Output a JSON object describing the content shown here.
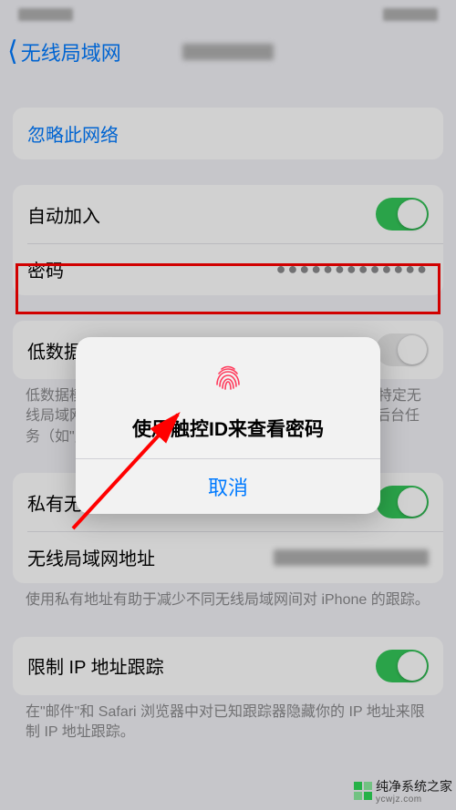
{
  "nav": {
    "back_label": "无线局域网"
  },
  "sections": {
    "forget_label": "忽略此网络",
    "auto_join_label": "自动加入",
    "password_label": "密码",
    "password_value": "●●●●●●●●●●●●●",
    "low_data_label": "低数据模式",
    "low_data_footer": "低数据模式有助于减少iPhone通过蜂窝网络或你选择的特定无线局域网使用的数据。打开低数据模式后，自动更新和后台任务（如\"照片\"同步）将会暂停。",
    "private_addr_label": "私有无线局域网地址",
    "wlan_addr_label": "无线局域网地址",
    "private_footer": "使用私有地址有助于减少不同无线局域网间对 iPhone 的跟踪。",
    "limit_ip_label": "限制 IP 地址跟踪",
    "limit_ip_footer": "在\"邮件\"和 Safari 浏览器中对已知跟踪器隐藏你的 IP 地址来限制 IP 地址跟踪。"
  },
  "alert": {
    "title": "使用触控ID来查看密码",
    "cancel": "取消"
  },
  "watermark": {
    "text": "纯净系统之家",
    "sub": "ycwjz.com"
  }
}
